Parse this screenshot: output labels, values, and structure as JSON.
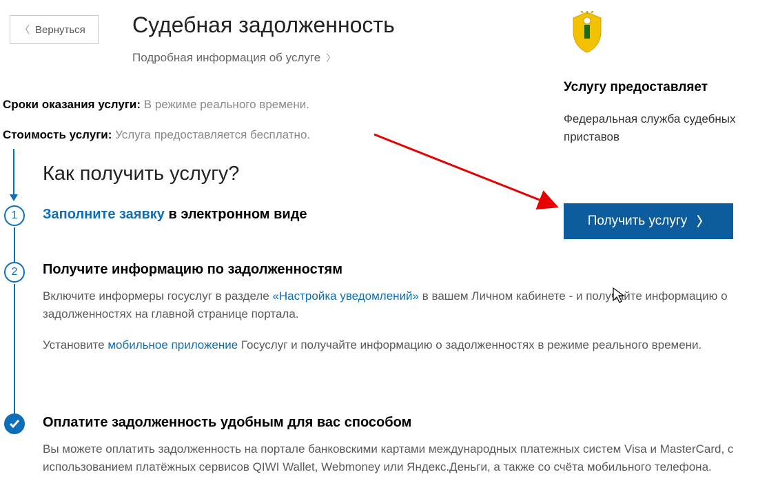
{
  "back_button": "Вернуться",
  "page_title": "Судебная задолженность",
  "details_link": "Подробная информация об услуге",
  "info": {
    "timing_label": "Сроки оказания услуги:",
    "timing_value": "В режиме реального времени.",
    "cost_label": "Стоимость услуги:",
    "cost_value": "Услуга предоставляется бесплатно."
  },
  "how_title": "Как получить услугу?",
  "steps": {
    "s1_blue": "Заполните заявку",
    "s1_rest": " в электронном виде",
    "s2_title": "Получите информацию по задолженностям",
    "s2_p1a": "Включите информеры госуслуг в разделе ",
    "s2_link1": "«Настройка уведомлений»",
    "s2_p1b": " в вашем Личном кабинете - и получайте информацию о задолженностях на главной странице портала.",
    "s2_p2a": "Установите ",
    "s2_link2": "мобильное приложение",
    "s2_p2b": " Госуслуг и получайте информацию о задолженностях в режиме реального времени.",
    "s3_title": "Оплатите задолженность удобным для вас способом",
    "s3_p1": "Вы можете оплатить задолженность на портале банковскими картами международных платежных систем Visa и MasterCard, с использованием платёжных сервисов QIWI Wallet, Webmoney или Яндекс.Деньги, а также со счёта мобильного телефона."
  },
  "sidebar": {
    "provider_title": "Услугу предоставляет",
    "provider_name": "Федеральная служба судебных приставов",
    "cta": "Получить услугу"
  },
  "numbers": {
    "one": "1",
    "two": "2"
  }
}
